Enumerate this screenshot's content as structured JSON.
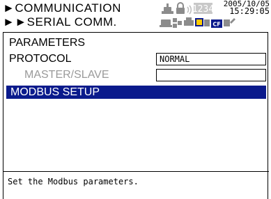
{
  "header": {
    "breadcrumb_1": "►COMMUNICATION",
    "breadcrumb_2": "►►SERIAL COMM.",
    "date": "2005/10/05",
    "time": "15:29:05",
    "status_badge": "1234",
    "cf_badge": "CF"
  },
  "panel": {
    "title": "PARAMETERS",
    "protocol_label": "PROTOCOL",
    "protocol_value": "NORMAL",
    "master_slave_label": "MASTER/SLAVE",
    "master_slave_value": "",
    "modbus_setup_label": "MODBUS SETUP"
  },
  "message": "Set the Modbus parameters.",
  "colors": {
    "selection": "#0a1a8c",
    "disabled_text": "#9a9a9a",
    "icon_gray": "#8c8c8c"
  },
  "icons": [
    "alarm-icon",
    "lock-icon",
    "signal-icon",
    "keylock-icon",
    "network-icon",
    "disk-icon",
    "printer-icon",
    "cf-card-icon",
    "floppy-icon",
    "satellite-icon"
  ]
}
